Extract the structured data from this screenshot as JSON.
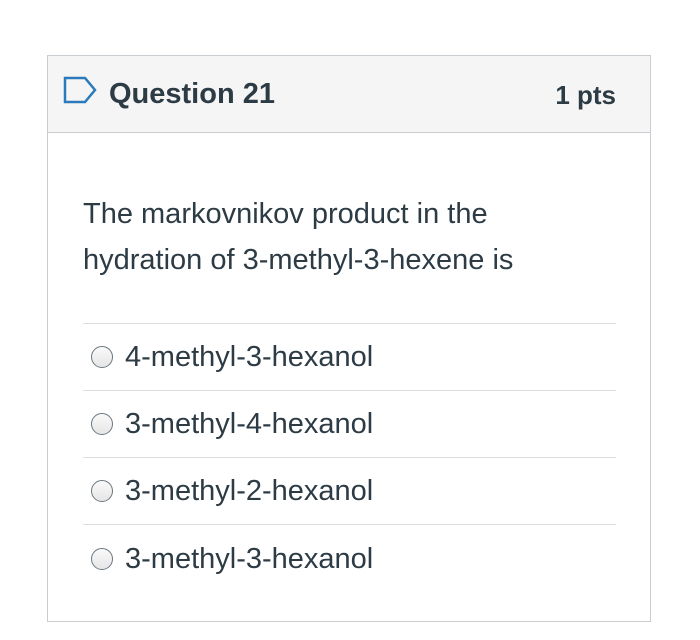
{
  "question": {
    "title": "Question 21",
    "points": "1 pts",
    "flag_icon": "flag-outline-icon",
    "text": "The markovnikov product in the hydration of 3-methyl-3-hexene is"
  },
  "answers": [
    {
      "label": "4-methyl-3-hexanol",
      "selected": false
    },
    {
      "label": "3-methyl-4-hexanol",
      "selected": false
    },
    {
      "label": "3-methyl-2-hexanol",
      "selected": false
    },
    {
      "label": "3-methyl-3-hexanol",
      "selected": false
    }
  ],
  "colors": {
    "text": "#2d3b45",
    "header_bg": "#f5f5f5",
    "border": "#c7cdd1",
    "flag": "#2b7abc"
  }
}
